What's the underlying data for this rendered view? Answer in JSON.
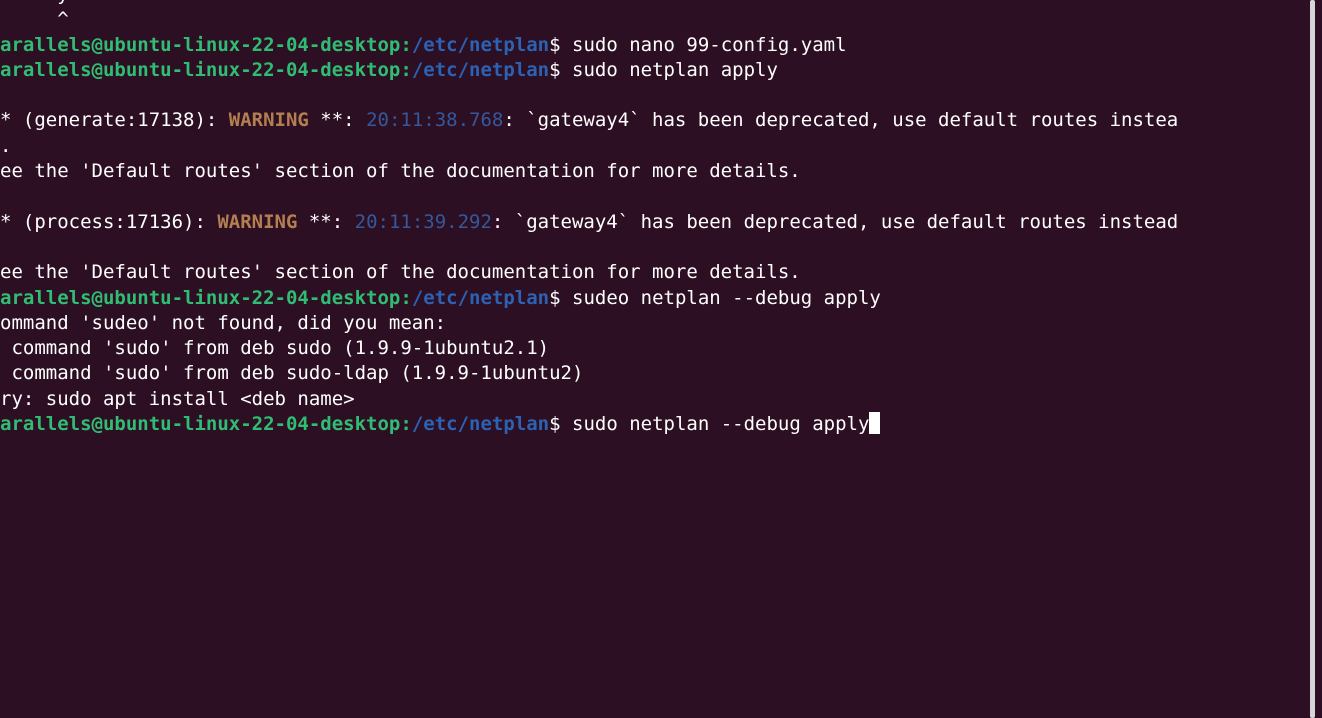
{
  "terminal": {
    "partial_top": "  i  y",
    "caret_line": "     ^",
    "prompt_user": "arallels@ubuntu-linux-22-04-desktop",
    "prompt_colon": ":",
    "prompt_path": "/etc/netplan",
    "prompt_symbol": "$ ",
    "cmd1": "sudo nano 99-config.yaml",
    "cmd2": "sudo netplan apply",
    "blank": "",
    "gen_prefix": "* (generate:17138): ",
    "warning_label": "WARNING",
    "warning_sep": " **: ",
    "gen_timestamp": "20:11:38.768",
    "gen_message": ": `gateway4` has been deprecated, use default routes instea",
    "dot_line": ".",
    "see_line": "ee the 'Default routes' section of the documentation for more details.",
    "proc_prefix": "* (process:17136): ",
    "proc_timestamp": "20:11:39.292",
    "proc_message": ": `gateway4` has been deprecated, use default routes instead",
    "cmd3": "sudeo netplan --debug apply",
    "not_found": "ommand 'sudeo' not found, did you mean:",
    "suggest1": " command 'sudo' from deb sudo (1.9.9-1ubuntu2.1)",
    "suggest2": " command 'sudo' from deb sudo-ldap (1.9.9-1ubuntu2)",
    "try_line": "ry: sudo apt install <deb name>",
    "cmd4": "sudo netplan --debug apply"
  },
  "colors": {
    "background": "#2c0f22",
    "prompt_user": "#30bd73",
    "prompt_path": "#2b62b4",
    "warning": "#b37f51",
    "timestamp": "#35589c",
    "text": "#ffffff"
  }
}
